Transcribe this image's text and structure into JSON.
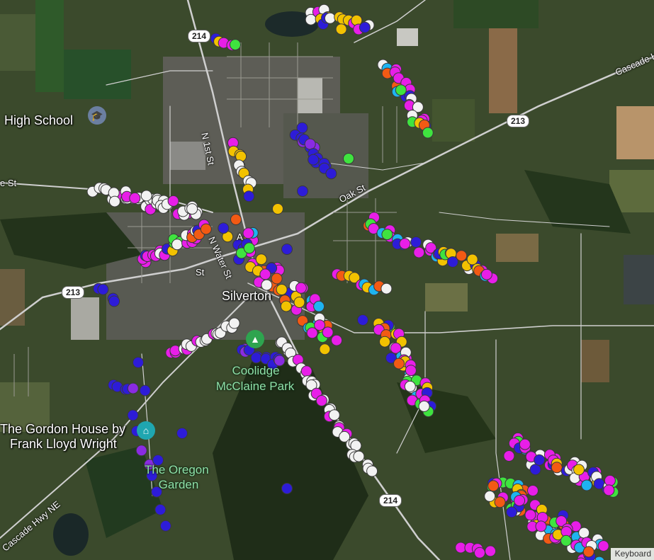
{
  "map": {
    "place_labels": [
      "High School",
      "Coolidge",
      "McClaine Park",
      "The Gordon House by",
      "Frank Lloyd Wright",
      "The Oregon",
      "Garden",
      "Silverton"
    ],
    "street_labels": [
      "N 1st St",
      "Oak St",
      "Cascade H",
      "Cascade Hwy NE",
      "e St",
      "N Water St",
      "A",
      "St"
    ],
    "shields": [
      "214",
      "213",
      "213",
      "214"
    ],
    "attribution": "Keyboard",
    "poi_icons": [
      "school-icon",
      "tree-icon",
      "museum-icon"
    ]
  },
  "colors": {
    "satellite_base": "#3b4a2c",
    "road": "#cfcfcf",
    "magenta": "#e81ee8",
    "yellow": "#f2c200",
    "blue": "#2d1cd8",
    "white": "#f2f2f2",
    "green": "#3fe33f",
    "orange": "#f25a14",
    "cyan": "#1eb4f0",
    "purple": "#8a2be2"
  }
}
